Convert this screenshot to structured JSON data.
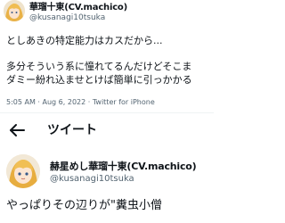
{
  "quoted_tweet": {
    "author_name": "華瑠十東(CV.machico)",
    "author_handle": "@kusanagi10tsuka",
    "lines": [
      "としあきの特定能力はカスだから...",
      "多分そういう系に憧れてるんだけどそこま",
      "ダミー紛れ込ませとけば簡単に引っかかる"
    ],
    "meta": "5:05 AM · Aug 6, 2022 · Twitter for iPhone"
  },
  "header": {
    "back_icon": "back-arrow-icon",
    "title": "ツイート"
  },
  "tweet": {
    "author_name": "赫星めし華瑠十東(CV.machico)",
    "author_handle": "@kusanagi10tsuka",
    "text": "やっぱりその辺りが\"糞虫小僧"
  },
  "colors": {
    "text": "#0f1419",
    "secondary": "#536471",
    "divider": "#eff3f4",
    "background": "#ffffff"
  }
}
